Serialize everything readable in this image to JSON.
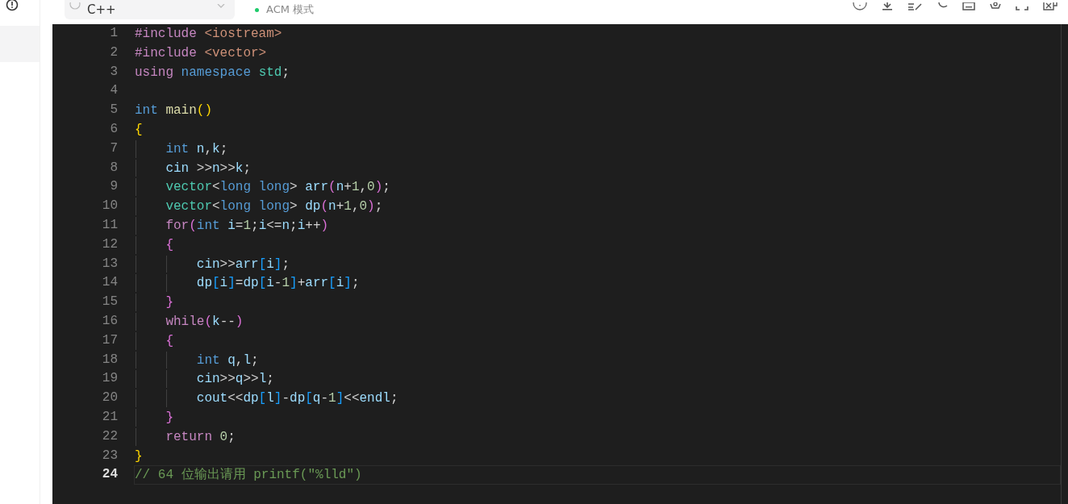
{
  "toolbar": {
    "language": "C++",
    "mode": "ACM 模式"
  },
  "editor": {
    "lines": [
      {
        "number": "1",
        "active": false,
        "tokens": [
          {
            "text": "#include",
            "kind": "keyword"
          },
          {
            "text": "<iostream>",
            "kind": "string",
            "space_before": true
          }
        ]
      },
      {
        "number": "2",
        "active": false,
        "tokens": [
          {
            "text": "#include",
            "kind": "keyword"
          },
          {
            "text": "<vector>",
            "kind": "string",
            "space_before": true
          }
        ]
      },
      {
        "number": "3",
        "active": false,
        "tokens": [
          {
            "text": "using",
            "kind": "keyword"
          },
          {
            "text": "namespace",
            "kind": "type",
            "space_before": true
          },
          {
            "text": "std",
            "kind": "class",
            "space_before": true
          },
          {
            "text": ";",
            "kind": "plain"
          }
        ]
      },
      {
        "number": "4",
        "active": false
      },
      {
        "number": "5",
        "active": false,
        "tokens": [
          {
            "text": "int",
            "kind": "type"
          },
          {
            "text": "main",
            "kind": "function",
            "space_before": true
          },
          {
            "text": "()",
            "kind": "bracket1"
          }
        ]
      },
      {
        "number": "6",
        "active": false,
        "tokens": [
          {
            "text": "{",
            "kind": "bracket1"
          }
        ],
        "children": [
          {
            "number": "7",
            "active": false,
            "tokens": [
              {
                "text": "int",
                "kind": "type"
              },
              {
                "text": "n",
                "kind": "variable",
                "space_before": true
              },
              {
                "text": ",",
                "kind": "plain"
              },
              {
                "text": "k",
                "kind": "variable"
              },
              {
                "text": ";",
                "kind": "plain"
              }
            ]
          },
          {
            "number": "8",
            "active": false,
            "tokens": [
              {
                "text": "cin",
                "kind": "variable"
              },
              {
                "text": ">>",
                "kind": "plain",
                "space_before": true
              },
              {
                "text": "n",
                "kind": "variable"
              },
              {
                "text": ">>",
                "kind": "plain"
              },
              {
                "text": "k",
                "kind": "variable"
              },
              {
                "text": ";",
                "kind": "plain"
              }
            ]
          },
          {
            "number": "9",
            "active": false,
            "tokens": [
              {
                "text": "vector",
                "kind": "class"
              },
              {
                "text": "<",
                "kind": "plain"
              },
              {
                "text": "long long",
                "kind": "type"
              },
              {
                "text": ">",
                "kind": "plain"
              },
              {
                "text": "arr",
                "kind": "variable",
                "space_before": true
              },
              {
                "text": "(",
                "kind": "bracket2"
              },
              {
                "text": "n",
                "kind": "variable"
              },
              {
                "text": "+",
                "kind": "plain"
              },
              {
                "text": "1",
                "kind": "number"
              },
              {
                "text": ",",
                "kind": "plain"
              },
              {
                "text": "0",
                "kind": "number"
              },
              {
                "text": ")",
                "kind": "bracket2"
              },
              {
                "text": ";",
                "kind": "plain"
              }
            ]
          },
          {
            "number": "10",
            "active": false,
            "tokens": [
              {
                "text": "vector",
                "kind": "class"
              },
              {
                "text": "<",
                "kind": "plain"
              },
              {
                "text": "long long",
                "kind": "type"
              },
              {
                "text": ">",
                "kind": "plain"
              },
              {
                "text": "dp",
                "kind": "variable",
                "space_before": true
              },
              {
                "text": "(",
                "kind": "bracket2"
              },
              {
                "text": "n",
                "kind": "variable"
              },
              {
                "text": "+",
                "kind": "plain"
              },
              {
                "text": "1",
                "kind": "number"
              },
              {
                "text": ",",
                "kind": "plain"
              },
              {
                "text": "0",
                "kind": "number"
              },
              {
                "text": ")",
                "kind": "bracket2"
              },
              {
                "text": ";",
                "kind": "plain"
              }
            ]
          },
          {
            "number": "11",
            "active": false,
            "tokens": [
              {
                "text": "for",
                "kind": "keyword"
              },
              {
                "text": "(",
                "kind": "bracket2"
              },
              {
                "text": "int",
                "kind": "type"
              },
              {
                "text": "i",
                "kind": "variable",
                "space_before": true
              },
              {
                "text": "=",
                "kind": "plain"
              },
              {
                "text": "1",
                "kind": "number"
              },
              {
                "text": ";",
                "kind": "plain"
              },
              {
                "text": "i",
                "kind": "variable"
              },
              {
                "text": "<=",
                "kind": "plain"
              },
              {
                "text": "n",
                "kind": "variable"
              },
              {
                "text": ";",
                "kind": "plain"
              },
              {
                "text": "i",
                "kind": "variable"
              },
              {
                "text": "++",
                "kind": "plain"
              },
              {
                "text": ")",
                "kind": "bracket2"
              }
            ]
          },
          {
            "number": "12",
            "active": false,
            "tokens": [
              {
                "text": "{",
                "kind": "bracket2"
              }
            ],
            "children": [
              {
                "number": "13",
                "active": false,
                "tokens": [
                  {
                    "text": "cin",
                    "kind": "variable"
                  },
                  {
                    "text": ">>",
                    "kind": "plain"
                  },
                  {
                    "text": "arr",
                    "kind": "variable"
                  },
                  {
                    "text": "[",
                    "kind": "bracket3"
                  },
                  {
                    "text": "i",
                    "kind": "variable"
                  },
                  {
                    "text": "]",
                    "kind": "bracket3"
                  },
                  {
                    "text": ";",
                    "kind": "plain"
                  }
                ]
              },
              {
                "number": "14",
                "active": false,
                "tokens": [
                  {
                    "text": "dp",
                    "kind": "variable"
                  },
                  {
                    "text": "[",
                    "kind": "bracket3"
                  },
                  {
                    "text": "i",
                    "kind": "variable"
                  },
                  {
                    "text": "]",
                    "kind": "bracket3"
                  },
                  {
                    "text": "=",
                    "kind": "plain"
                  },
                  {
                    "text": "dp",
                    "kind": "variable"
                  },
                  {
                    "text": "[",
                    "kind": "bracket3"
                  },
                  {
                    "text": "i",
                    "kind": "variable"
                  },
                  {
                    "text": "-",
                    "kind": "plain"
                  },
                  {
                    "text": "1",
                    "kind": "number"
                  },
                  {
                    "text": "]",
                    "kind": "bracket3"
                  },
                  {
                    "text": "+",
                    "kind": "plain"
                  },
                  {
                    "text": "arr",
                    "kind": "variable"
                  },
                  {
                    "text": "[",
                    "kind": "bracket3"
                  },
                  {
                    "text": "i",
                    "kind": "variable"
                  },
                  {
                    "text": "]",
                    "kind": "bracket3"
                  },
                  {
                    "text": ";",
                    "kind": "plain"
                  }
                ]
              }
            ]
          },
          {
            "number": "15",
            "active": false,
            "tokens": [
              {
                "text": "}",
                "kind": "bracket2"
              }
            ]
          },
          {
            "number": "16",
            "active": false,
            "tokens": [
              {
                "text": "while",
                "kind": "keyword"
              },
              {
                "text": "(",
                "kind": "bracket2"
              },
              {
                "text": "k",
                "kind": "variable"
              },
              {
                "text": "--",
                "kind": "plain"
              },
              {
                "text": ")",
                "kind": "bracket2"
              }
            ]
          },
          {
            "number": "17",
            "active": false,
            "tokens": [
              {
                "text": "{",
                "kind": "bracket2"
              }
            ],
            "children": [
              {
                "number": "18",
                "active": false,
                "tokens": [
                  {
                    "text": "int",
                    "kind": "type"
                  },
                  {
                    "text": "q",
                    "kind": "variable",
                    "space_before": true
                  },
                  {
                    "text": ",",
                    "kind": "plain"
                  },
                  {
                    "text": "l",
                    "kind": "variable"
                  },
                  {
                    "text": ";",
                    "kind": "plain"
                  }
                ]
              },
              {
                "number": "19",
                "active": false,
                "tokens": [
                  {
                    "text": "cin",
                    "kind": "variable"
                  },
                  {
                    "text": ">>",
                    "kind": "plain"
                  },
                  {
                    "text": "q",
                    "kind": "variable"
                  },
                  {
                    "text": ">>",
                    "kind": "plain"
                  },
                  {
                    "text": "l",
                    "kind": "variable"
                  },
                  {
                    "text": ";",
                    "kind": "plain"
                  }
                ]
              },
              {
                "number": "20",
                "active": false,
                "tokens": [
                  {
                    "text": "cout",
                    "kind": "variable"
                  },
                  {
                    "text": "<<",
                    "kind": "plain"
                  },
                  {
                    "text": "dp",
                    "kind": "variable"
                  },
                  {
                    "text": "[",
                    "kind": "bracket3"
                  },
                  {
                    "text": "l",
                    "kind": "variable"
                  },
                  {
                    "text": "]",
                    "kind": "bracket3"
                  },
                  {
                    "text": "-",
                    "kind": "plain"
                  },
                  {
                    "text": "dp",
                    "kind": "variable"
                  },
                  {
                    "text": "[",
                    "kind": "bracket3"
                  },
                  {
                    "text": "q",
                    "kind": "variable"
                  },
                  {
                    "text": "-",
                    "kind": "plain"
                  },
                  {
                    "text": "1",
                    "kind": "number"
                  },
                  {
                    "text": "]",
                    "kind": "bracket3"
                  },
                  {
                    "text": "<<",
                    "kind": "plain"
                  },
                  {
                    "text": "endl",
                    "kind": "variable"
                  },
                  {
                    "text": ";",
                    "kind": "plain"
                  }
                ]
              }
            ]
          },
          {
            "number": "21",
            "active": false,
            "tokens": [
              {
                "text": "}",
                "kind": "bracket2"
              }
            ]
          },
          {
            "number": "22",
            "active": false,
            "tokens": [
              {
                "text": "return",
                "kind": "keyword"
              },
              {
                "text": "0",
                "kind": "number",
                "space_before": true
              },
              {
                "text": ";",
                "kind": "plain"
              }
            ]
          }
        ]
      },
      {
        "number": "23",
        "active": false,
        "tokens": [
          {
            "text": "}",
            "kind": "bracket1"
          }
        ]
      },
      {
        "number": "24",
        "active": true,
        "tokens": [
          {
            "text": "// 64 位输出请用 printf(\"%lld\")",
            "kind": "comment"
          }
        ]
      }
    ]
  }
}
